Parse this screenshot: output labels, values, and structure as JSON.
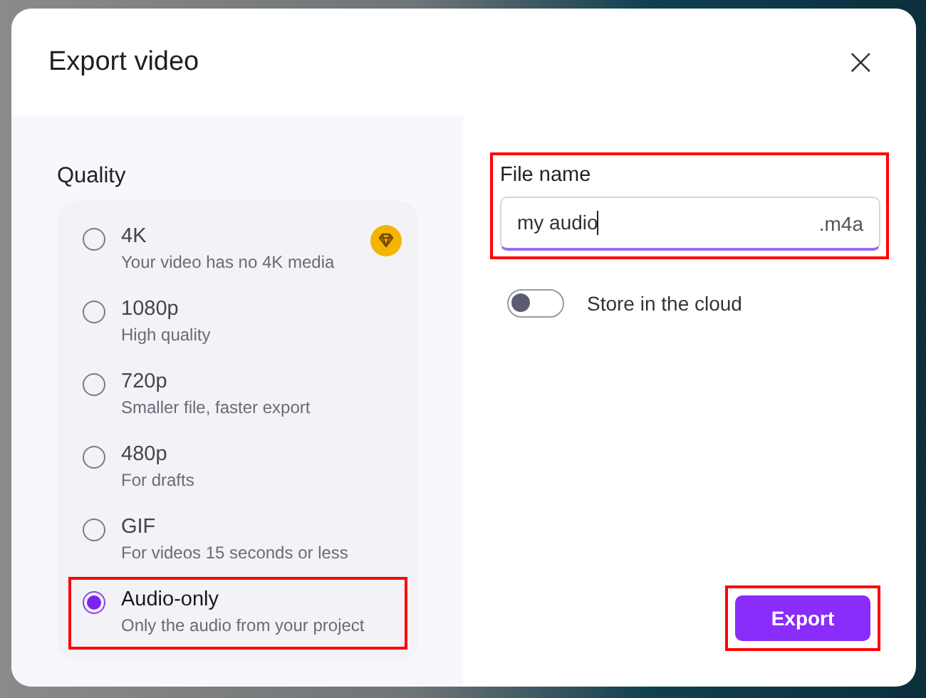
{
  "dialog": {
    "title": "Export video",
    "close_label": "×"
  },
  "quality": {
    "label": "Quality",
    "options": [
      {
        "label": "4K",
        "description": "Your video has no 4K media",
        "selected": false,
        "premium": true,
        "highlighted": false
      },
      {
        "label": "1080p",
        "description": "High quality",
        "selected": false,
        "premium": false,
        "highlighted": false
      },
      {
        "label": "720p",
        "description": "Smaller file, faster export",
        "selected": false,
        "premium": false,
        "highlighted": false
      },
      {
        "label": "480p",
        "description": "For drafts",
        "selected": false,
        "premium": false,
        "highlighted": false
      },
      {
        "label": "GIF",
        "description": "For videos 15 seconds or less",
        "selected": false,
        "premium": false,
        "highlighted": false
      },
      {
        "label": "Audio-only",
        "description": "Only the audio from your project",
        "selected": true,
        "premium": false,
        "highlighted": true
      }
    ]
  },
  "file_name": {
    "label": "File name",
    "value": "my audio",
    "extension": ".m4a",
    "highlighted": true
  },
  "cloud_toggle": {
    "label": "Store in the cloud",
    "on": false
  },
  "export_button": {
    "label": "Export",
    "highlighted": true
  }
}
